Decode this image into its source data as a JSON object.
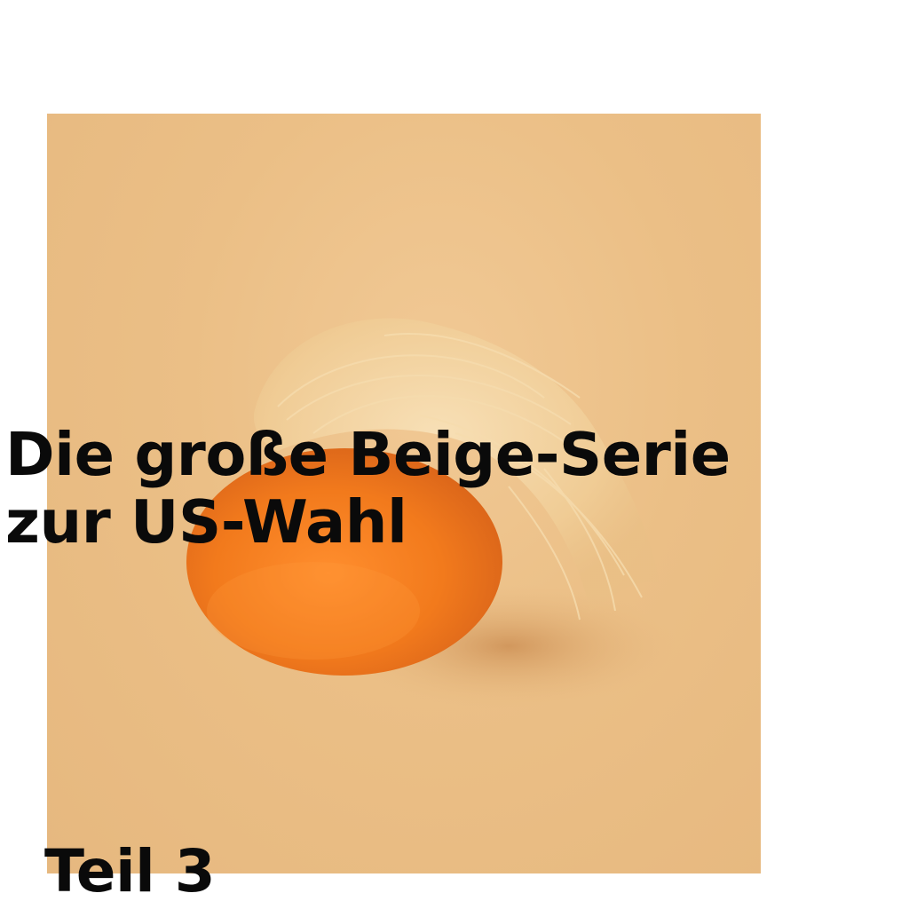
{
  "headline": {
    "line1": "Die große Beige-Serie",
    "line2": "zur US-Wahl"
  },
  "part_label": "Teil 3",
  "colors": {
    "background": "#ffffff",
    "photo_backdrop": "#e8bb82",
    "orange": "#f07f22",
    "hair": "#f3d3a0",
    "text": "#0a0a0a"
  },
  "photo": {
    "subject": "orange-with-blond-hair-wig"
  }
}
